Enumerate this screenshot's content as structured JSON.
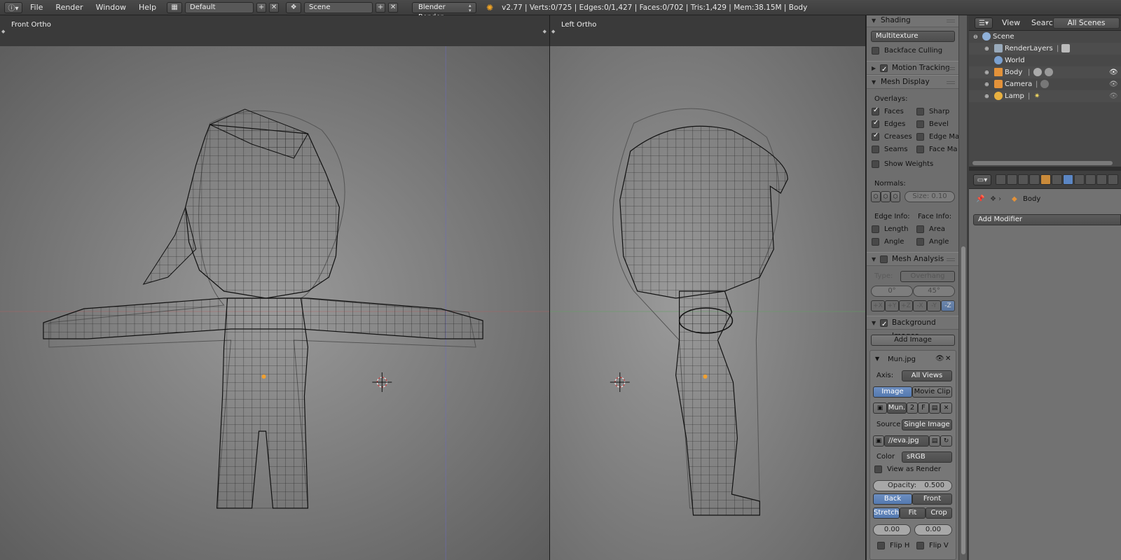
{
  "topbar": {
    "menus": [
      "File",
      "Render",
      "Window",
      "Help"
    ],
    "screen_layout": "Default",
    "scene": "Scene",
    "engine": "Blender Render",
    "stats": "v2.77 | Verts:0/725 | Edges:0/1,427 | Faces:0/702 | Tris:1,429 | Mem:38.15M | Body",
    "add_symbol": "+",
    "close_symbol": "✕"
  },
  "viewports": {
    "left": {
      "title": "Front Ortho"
    },
    "right": {
      "title": "Left Ortho"
    }
  },
  "properties": {
    "shading": {
      "header": "Shading",
      "mode": "Multitexture",
      "backface_culling": {
        "label": "Backface Culling",
        "checked": false
      }
    },
    "motion_tracking": {
      "header": "Motion Tracking"
    },
    "mesh_display": {
      "header": "Mesh Display",
      "overlays_label": "Overlays:",
      "faces": "Faces",
      "edges": "Edges",
      "creases": "Creases",
      "seams": "Seams",
      "sharp": "Sharp",
      "bevel": "Bevel",
      "edge_marks": "Edge Ma",
      "face_marks": "Face Ma",
      "show_weights": "Show Weights",
      "normals_label": "Normals:",
      "size_value": "Size: 0.10",
      "edge_info": "Edge Info:",
      "face_info": "Face Info:",
      "length": "Length",
      "area": "Area",
      "edge_angle": "Angle",
      "face_angle": "Angle"
    },
    "mesh_analysis": {
      "header": "Mesh Analysis",
      "type_label": "Type:",
      "type_value": "Overhang",
      "min": "0°",
      "max": "45°",
      "axes": [
        "+X",
        "+Y",
        "+Z",
        "-X",
        "-Y",
        "-Z"
      ],
      "active_axis": "-Z"
    },
    "background_images": {
      "header": "Background Images",
      "add_image": "Add Image",
      "image_name": "Mun.jpg",
      "axis_label": "Axis:",
      "axis_value": "All Views",
      "tab_image": "Image",
      "tab_movie": "Movie Clip",
      "datablock_name": "Mun.",
      "users": "2",
      "fake_user": "F",
      "source_label": "Source",
      "source_value": "Single Image",
      "filepath": "//eva.jpg",
      "color_label": "Color",
      "color_value": "sRGB",
      "view_as_render": "View as Render",
      "opacity_label": "Opacity:",
      "opacity_value": "0.500",
      "back": "Back",
      "front": "Front",
      "stretch": "Stretch",
      "fit": "Fit",
      "crop": "Crop",
      "offset_x": "0.00",
      "offset_y": "0.00",
      "flip_h": "Flip H",
      "flip_v": "Flip V"
    }
  },
  "outliner": {
    "view": "View",
    "search": "Search",
    "filter": "All Scenes",
    "items": [
      {
        "name": "Scene",
        "depth": 0
      },
      {
        "name": "RenderLayers",
        "depth": 1
      },
      {
        "name": "World",
        "depth": 1
      },
      {
        "name": "Body",
        "depth": 1
      },
      {
        "name": "Camera",
        "depth": 1
      },
      {
        "name": "Lamp",
        "depth": 1
      }
    ]
  },
  "modifiers": {
    "object_name": "Body",
    "add_modifier": "Add Modifier"
  }
}
